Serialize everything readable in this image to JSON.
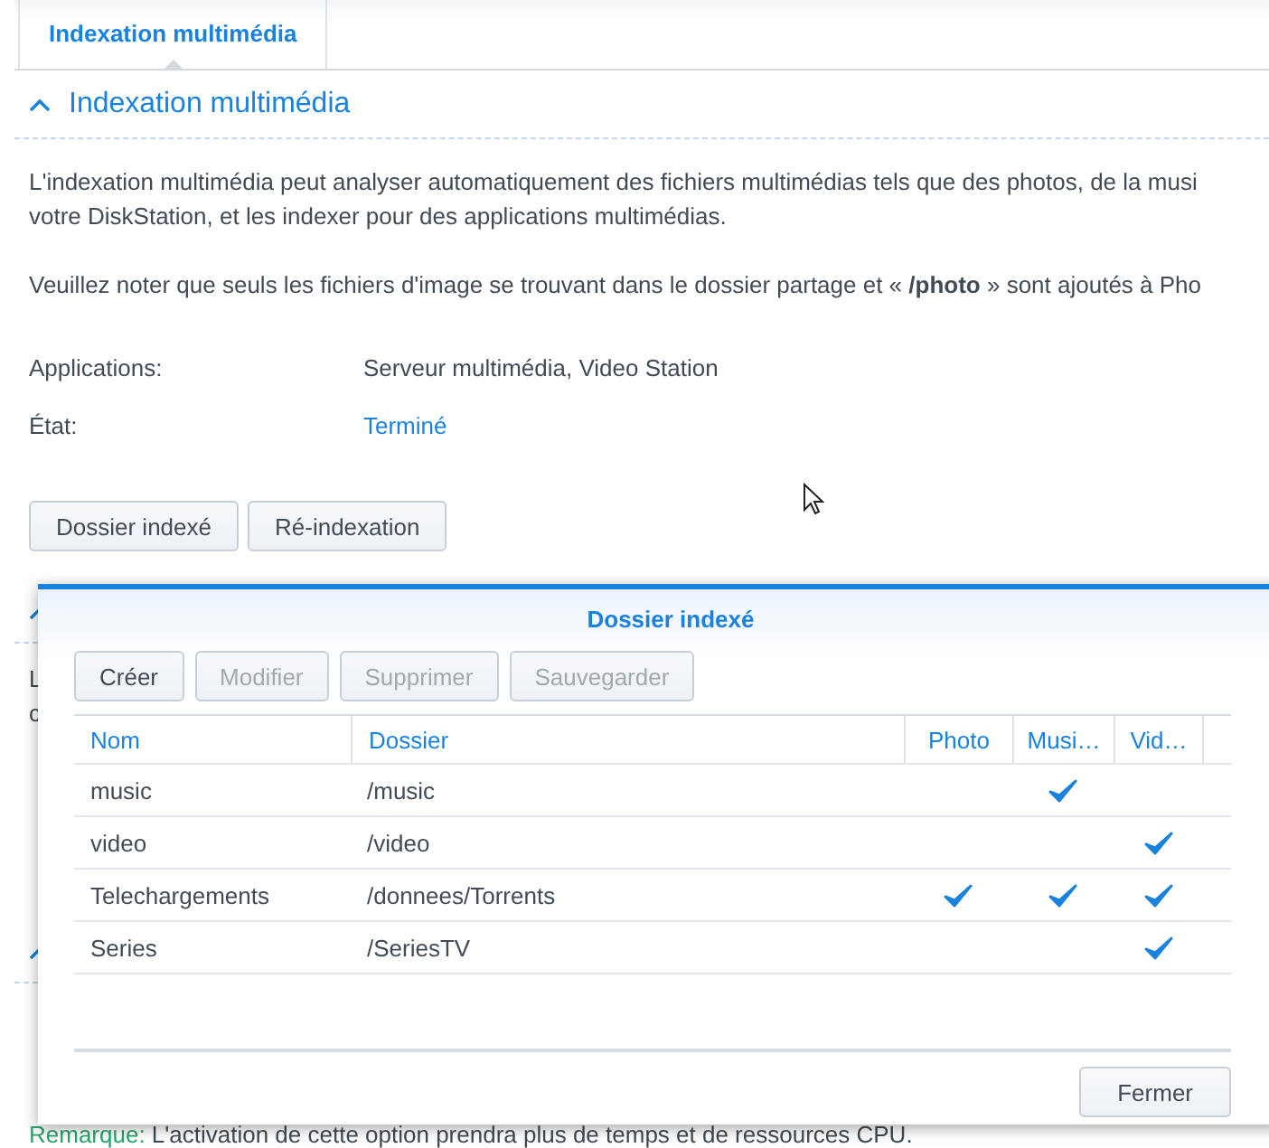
{
  "tabs": [
    {
      "label": "Indexation multimédia",
      "selected": true
    }
  ],
  "section": {
    "title": "Indexation multimédia",
    "expanded": true,
    "lines": [
      [
        "L'indexation multimédia peut analyser automatiquement des fichiers multimédias tels que des photos, de la musi",
        "votre DiskStation, et les indexer pour des applications multimédias."
      ],
      [
        "Veuillez noter que seuls les fichiers d'image se trouvant dans le dossier partage et « **/photo** » sont ajoutés à Pho"
      ]
    ],
    "fields": [
      {
        "label": "Applications:",
        "value": "Serveur multimédia, Video Station",
        "kind": "text"
      },
      {
        "label": "État:",
        "value": "Terminé",
        "kind": "status"
      }
    ],
    "buttons": [
      "Dossier indexé",
      "Ré-indexation"
    ]
  },
  "hidden_sections": [
    {
      "expanded": true,
      "paragraphs": [
        [
          "L",
          "c"
        ]
      ]
    },
    {
      "expanded": true,
      "remark": {
        "label": "Remarque:",
        "text": " L'activation de cette option prendra plus de temps et de ressources CPU."
      }
    }
  ],
  "dialog": {
    "title": "Dossier indexé",
    "toolbar": [
      {
        "label": "Créer",
        "disabled": false
      },
      {
        "label": "Modifier",
        "disabled": true
      },
      {
        "label": "Supprimer",
        "disabled": true
      },
      {
        "label": "Sauvegarder",
        "disabled": true
      }
    ],
    "columns": [
      "Nom",
      "Dossier",
      "Photo",
      "Musi…",
      "Vid…"
    ],
    "rows": [
      {
        "name": "music",
        "folder": "/music",
        "photo": false,
        "music": true,
        "video": false
      },
      {
        "name": "video",
        "folder": "/video",
        "photo": false,
        "music": false,
        "video": true
      },
      {
        "name": "Telechargements",
        "folder": "/donnees/Torrents",
        "photo": true,
        "music": true,
        "video": true
      },
      {
        "name": "Series",
        "folder": "/SeriesTV",
        "photo": false,
        "music": false,
        "video": true
      }
    ],
    "buttons": [
      "Fermer"
    ]
  }
}
